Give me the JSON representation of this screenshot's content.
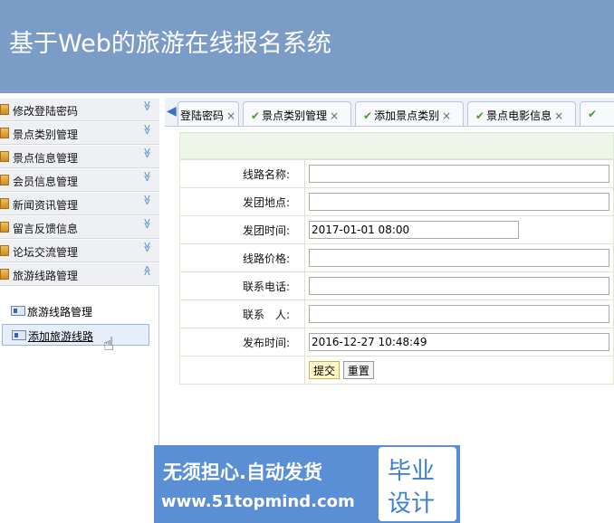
{
  "header": {
    "title": "基于Web的旅游在线报名系统"
  },
  "sidebar": {
    "items": [
      {
        "label": "修改登陆密码"
      },
      {
        "label": "景点类别管理"
      },
      {
        "label": "景点信息管理"
      },
      {
        "label": "会员信息管理"
      },
      {
        "label": "新闻资讯管理"
      },
      {
        "label": "留言反馈信息"
      },
      {
        "label": "论坛交流管理"
      },
      {
        "label": "旅游线路管理"
      }
    ],
    "sub_items": [
      {
        "label": "旅游线路管理"
      },
      {
        "label": "添加旅游线路"
      }
    ],
    "chevron_down": "≫",
    "chevron_up": "≪"
  },
  "tabs": [
    {
      "label": "登陆密码",
      "close": "×"
    },
    {
      "label": "景点类别管理",
      "close": "×"
    },
    {
      "label": "添加景点类别",
      "close": "×"
    },
    {
      "label": "景点电影信息",
      "close": "×"
    },
    {
      "label": "",
      "close": ""
    }
  ],
  "tab_nav": "◀",
  "check": "✔",
  "form": {
    "fields": [
      {
        "label": "线路名称:",
        "value": ""
      },
      {
        "label": "发团地点:",
        "value": ""
      },
      {
        "label": "发团时间:",
        "value": "2017-01-01 08:00"
      },
      {
        "label": "线路价格:",
        "value": ""
      },
      {
        "label": "联系电话:",
        "value": ""
      },
      {
        "label": "联系　人:",
        "value": ""
      },
      {
        "label": "发布时间:",
        "value": "2016-12-27 10:48:49"
      }
    ],
    "submit": "提交",
    "reset": "重置"
  },
  "banner": {
    "line1": "无须担心.自动发货",
    "line2": "www.51topmind.com",
    "box1": "毕业",
    "box2": "设计"
  }
}
